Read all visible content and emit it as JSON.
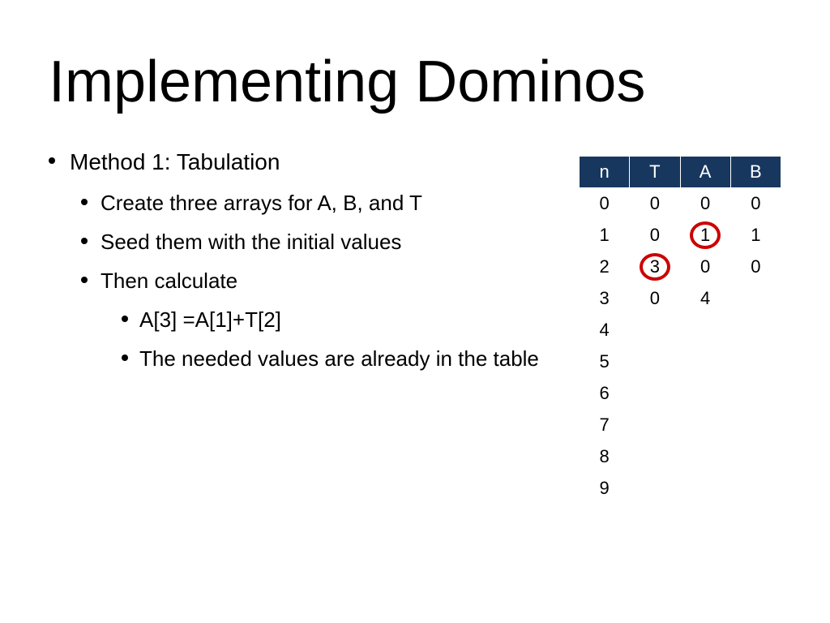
{
  "title": "Implementing Dominos",
  "bullets": {
    "l1": "Method 1: Tabulation",
    "l2a": "Create three arrays for A, B, and T",
    "l2b": "Seed them with the initial values",
    "l2c": "Then calculate",
    "l3a": "A[3] =A[1]+T[2]",
    "l3b": "The needed values are already in the table"
  },
  "table": {
    "headers": [
      "n",
      "T",
      "A",
      "B"
    ],
    "rows": [
      [
        "0",
        "0",
        "0",
        "0"
      ],
      [
        "1",
        "0",
        "1",
        "1"
      ],
      [
        "2",
        "3",
        "0",
        "0"
      ],
      [
        "3",
        "0",
        "4",
        ""
      ],
      [
        "4",
        "",
        "",
        ""
      ],
      [
        "5",
        "",
        "",
        ""
      ],
      [
        "6",
        "",
        "",
        ""
      ],
      [
        "7",
        "",
        "",
        ""
      ],
      [
        "8",
        "",
        "",
        ""
      ],
      [
        "9",
        "",
        "",
        ""
      ]
    ]
  },
  "circles": [
    {
      "row": 1,
      "col": 2
    },
    {
      "row": 2,
      "col": 1
    }
  ]
}
